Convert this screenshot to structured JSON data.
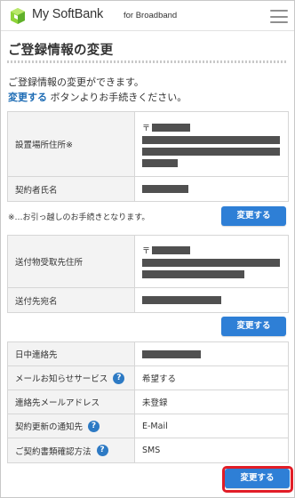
{
  "header": {
    "logo_text": "My SoftBank",
    "logo_sub": "for Broadband"
  },
  "page": {
    "title": "ご登録情報の変更",
    "intro_line1": "ご登録情報の変更ができます。",
    "intro_link": "変更する",
    "intro_line2_rest": " ボタンよりお手続きください。"
  },
  "install": {
    "address_label": "設置場所住所※",
    "address_zip_prefix": "〒",
    "name_label": "契約者氏名",
    "note": "※…お引っ越しのお手続きとなります。",
    "change_button": "変更する"
  },
  "shipping": {
    "address_label": "送付物受取先住所",
    "address_zip_prefix": "〒",
    "name_label": "送付先宛名",
    "change_button": "変更する"
  },
  "contact": {
    "rows": [
      {
        "label": "日中連絡先",
        "value": "",
        "help": false
      },
      {
        "label": "メールお知らせサービス",
        "value": "希望する",
        "help": true
      },
      {
        "label": "連絡先メールアドレス",
        "value": "未登録",
        "help": false
      },
      {
        "label": "契約更新の通知先",
        "value": "E-Mail",
        "help": true
      },
      {
        "label": "ご契約書類確認方法",
        "value": "SMS",
        "help": true
      }
    ],
    "help_glyph": "?",
    "change_button": "変更する"
  },
  "colors": {
    "accent": "#2e7fd6",
    "link": "#1c6bb4",
    "highlight": "#e11d27",
    "redacted": "#505050"
  }
}
